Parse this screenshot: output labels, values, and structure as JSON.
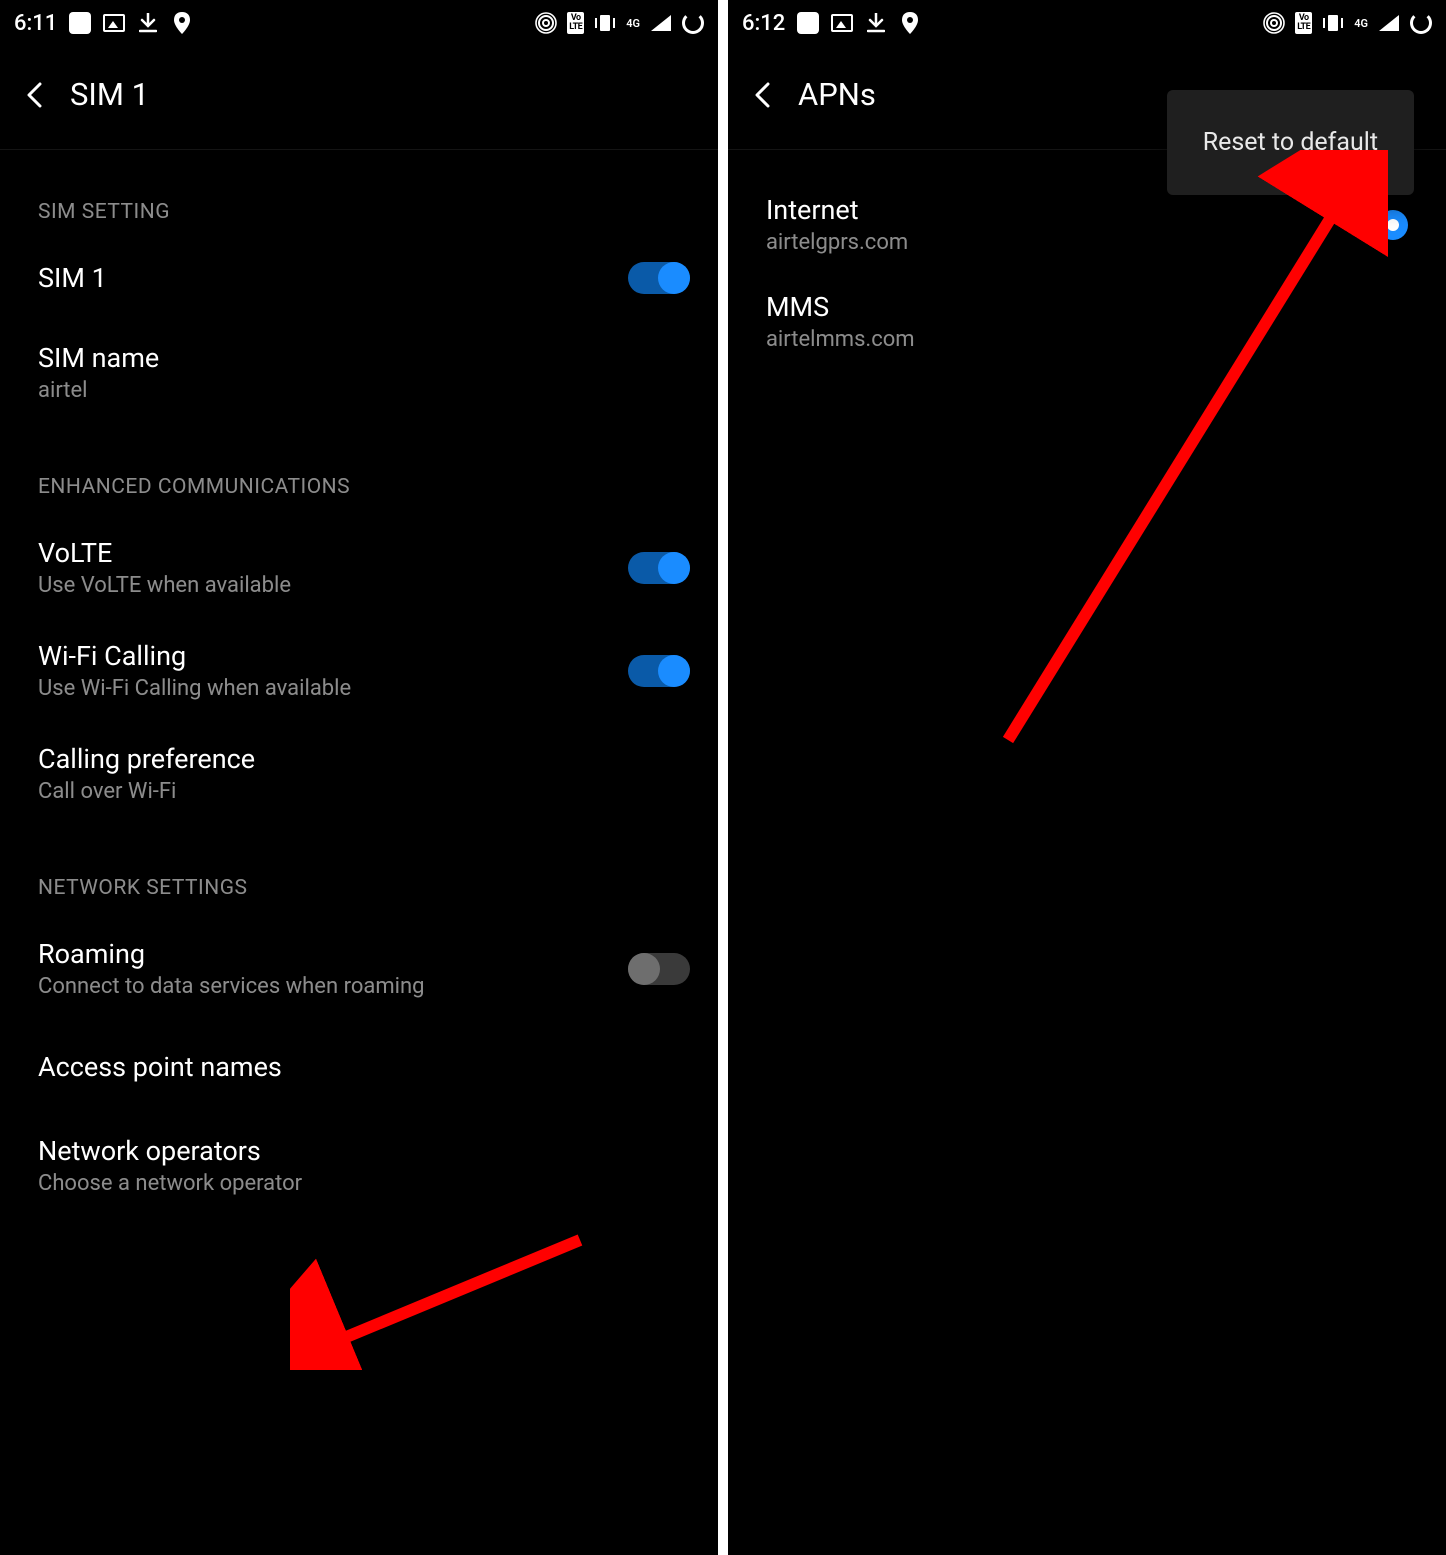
{
  "left": {
    "status": {
      "time": "6:11"
    },
    "title": "SIM 1",
    "sections": {
      "simSetting": {
        "header": "SIM SETTING",
        "sim1": {
          "label": "SIM 1",
          "on": true
        },
        "simName": {
          "label": "SIM name",
          "value": "airtel"
        }
      },
      "enhancedCommunications": {
        "header": "ENHANCED COMMUNICATIONS",
        "volte": {
          "label": "VoLTE",
          "sub": "Use VoLTE when available",
          "on": true
        },
        "wifiCalling": {
          "label": "Wi-Fi Calling",
          "sub": "Use Wi-Fi Calling when available",
          "on": true
        },
        "callingPreference": {
          "label": "Calling preference",
          "sub": "Call over Wi-Fi"
        }
      },
      "networkSettings": {
        "header": "NETWORK SETTINGS",
        "roaming": {
          "label": "Roaming",
          "sub": "Connect to data services when roaming",
          "on": false
        },
        "apn": {
          "label": "Access point names"
        },
        "operators": {
          "label": "Network operators",
          "sub": "Choose a network operator"
        }
      }
    }
  },
  "right": {
    "status": {
      "time": "6:12"
    },
    "title": "APNs",
    "popup": {
      "label": "Reset to default"
    },
    "apns": [
      {
        "name": "Internet",
        "host": "airtelgprs.com",
        "selected": true
      },
      {
        "name": "MMS",
        "host": "airtelmms.com",
        "selected": false
      }
    ]
  }
}
